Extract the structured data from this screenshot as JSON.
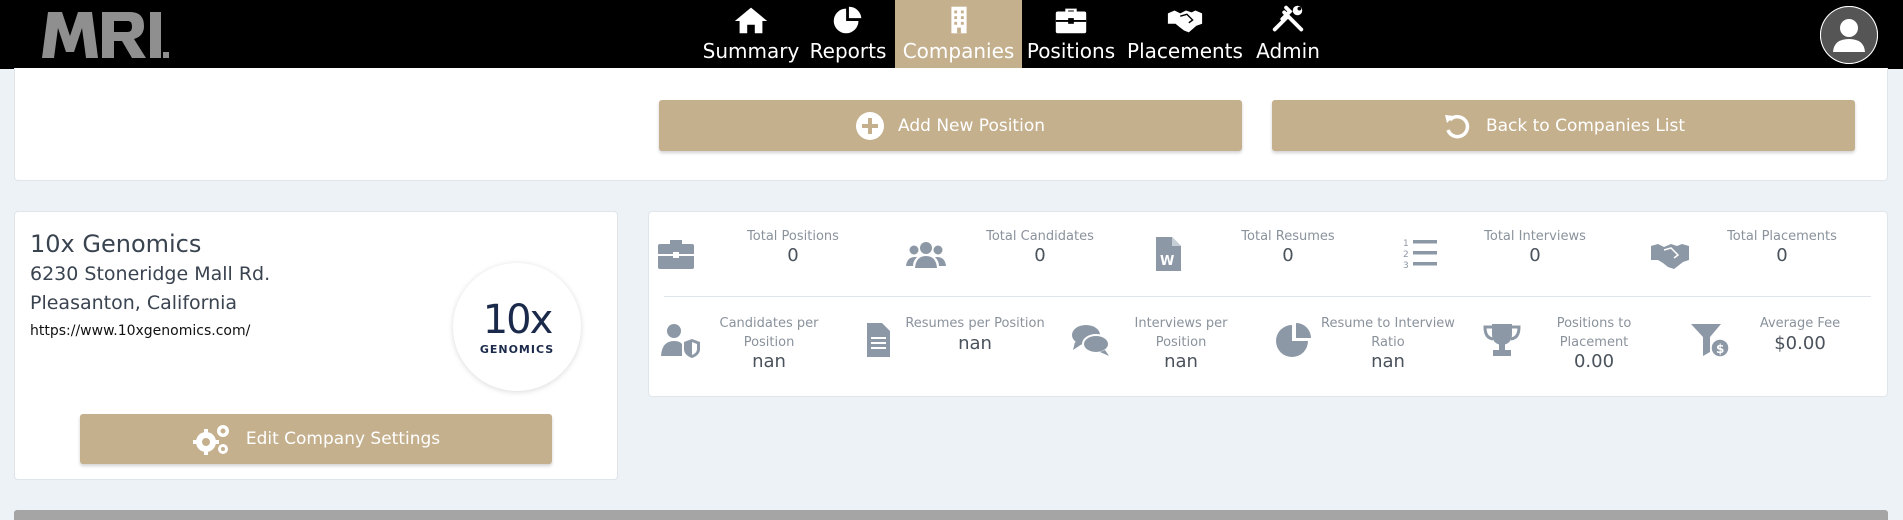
{
  "app": {
    "logo_text": "MRI."
  },
  "nav": {
    "items": [
      {
        "label": "Summary",
        "icon": "home-icon"
      },
      {
        "label": "Reports",
        "icon": "pie-chart-icon"
      },
      {
        "label": "Companies",
        "icon": "building-icon",
        "active": true
      },
      {
        "label": "Positions",
        "icon": "briefcase-icon"
      },
      {
        "label": "Placements",
        "icon": "handshake-icon"
      },
      {
        "label": "Admin",
        "icon": "tools-icon"
      }
    ]
  },
  "actions": {
    "add_position": "Add New Position",
    "back_to_list": "Back to Companies List"
  },
  "company": {
    "name": "10x Genomics",
    "address_line1": "6230 Stoneridge Mall Rd.",
    "address_line2": "Pleasanton, California",
    "url": "https://www.10xgenomics.com/",
    "logo_big": "10x",
    "logo_small": "GENOMICS",
    "edit_label": "Edit Company Settings"
  },
  "stats": {
    "row1": [
      {
        "label": "Total Positions",
        "value": "0",
        "icon": "briefcase-icon"
      },
      {
        "label": "Total Candidates",
        "value": "0",
        "icon": "users-icon"
      },
      {
        "label": "Total Resumes",
        "value": "0",
        "icon": "word-file-icon"
      },
      {
        "label": "Total Interviews",
        "value": "0",
        "icon": "numbered-list-icon"
      },
      {
        "label": "Total Placements",
        "value": "0",
        "icon": "handshake-icon"
      }
    ],
    "row2": [
      {
        "label": "Candidates per Position",
        "value": "nan",
        "icon": "user-shield-icon"
      },
      {
        "label": "Resumes per Position",
        "value": "nan",
        "icon": "document-icon"
      },
      {
        "label": "Interviews per Position",
        "value": "nan",
        "icon": "comments-icon"
      },
      {
        "label": "Resume to Interview Ratio",
        "value": "nan",
        "icon": "pie-chart-icon"
      },
      {
        "label": "Positions to Placement",
        "value": "0.00",
        "icon": "trophy-icon"
      },
      {
        "label": "Average Fee",
        "value": "$0.00",
        "icon": "funnel-dollar-icon"
      }
    ]
  },
  "colors": {
    "accent": "#c5b08e",
    "nav_bg": "#000000",
    "icon_gray": "#8c98a6"
  }
}
